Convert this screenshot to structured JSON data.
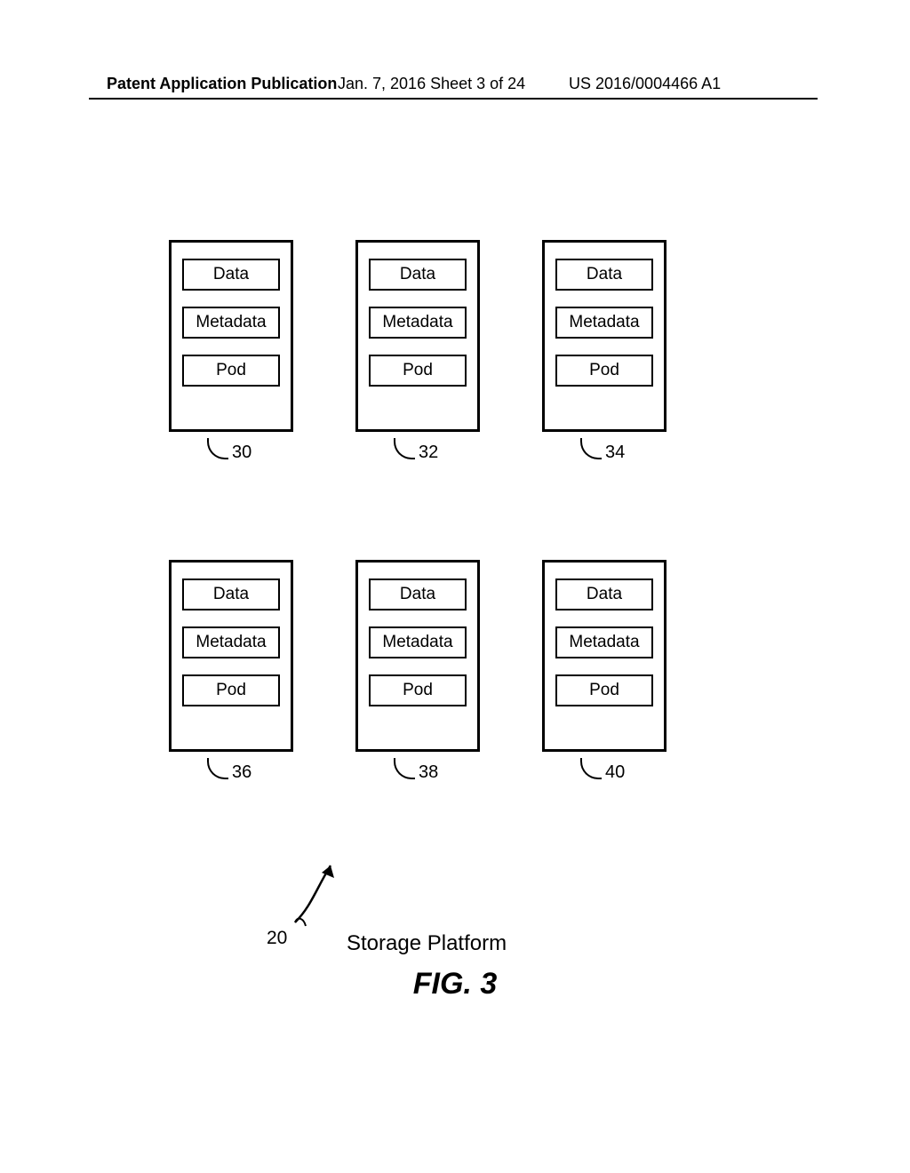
{
  "header": {
    "left": "Patent Application Publication",
    "center": "Jan. 7, 2016  Sheet 3 of 24",
    "right": "US 2016/0004466 A1"
  },
  "box_labels": {
    "data": "Data",
    "metadata": "Metadata",
    "pod": "Pod"
  },
  "refs": {
    "r0": "30",
    "r1": "32",
    "r2": "34",
    "r3": "36",
    "r4": "38",
    "r5": "40",
    "platform": "20"
  },
  "captions": {
    "platform": "Storage Platform",
    "figure": "FIG. 3"
  }
}
